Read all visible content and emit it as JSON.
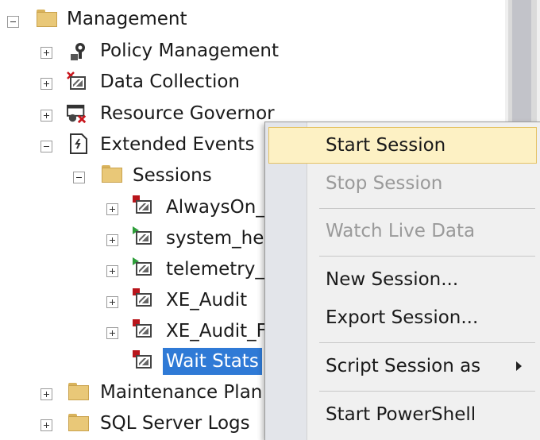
{
  "tree": {
    "management": "Management",
    "policy_management": "Policy Management",
    "data_collection": "Data Collection",
    "resource_governor": "Resource Governor",
    "extended_events": "Extended Events",
    "sessions": "Sessions",
    "session_items": [
      "AlwaysOn_",
      "system_he",
      "telemetry_",
      "XE_Audit",
      "XE_Audit_F",
      "Wait Stats"
    ],
    "maintenance_plans": "Maintenance Plan",
    "sql_server_logs": "SQL Server Logs"
  },
  "context_menu": {
    "start_session": "Start Session",
    "stop_session": "Stop Session",
    "watch_live_data": "Watch Live Data",
    "new_session": "New Session...",
    "export_session": "Export Session...",
    "script_session_as": "Script Session as",
    "start_powershell": "Start PowerShell"
  },
  "colors": {
    "selection": "#2f7ad6",
    "menu_hover": "#fdf1c4",
    "disabled_text": "#9a9a9a"
  }
}
